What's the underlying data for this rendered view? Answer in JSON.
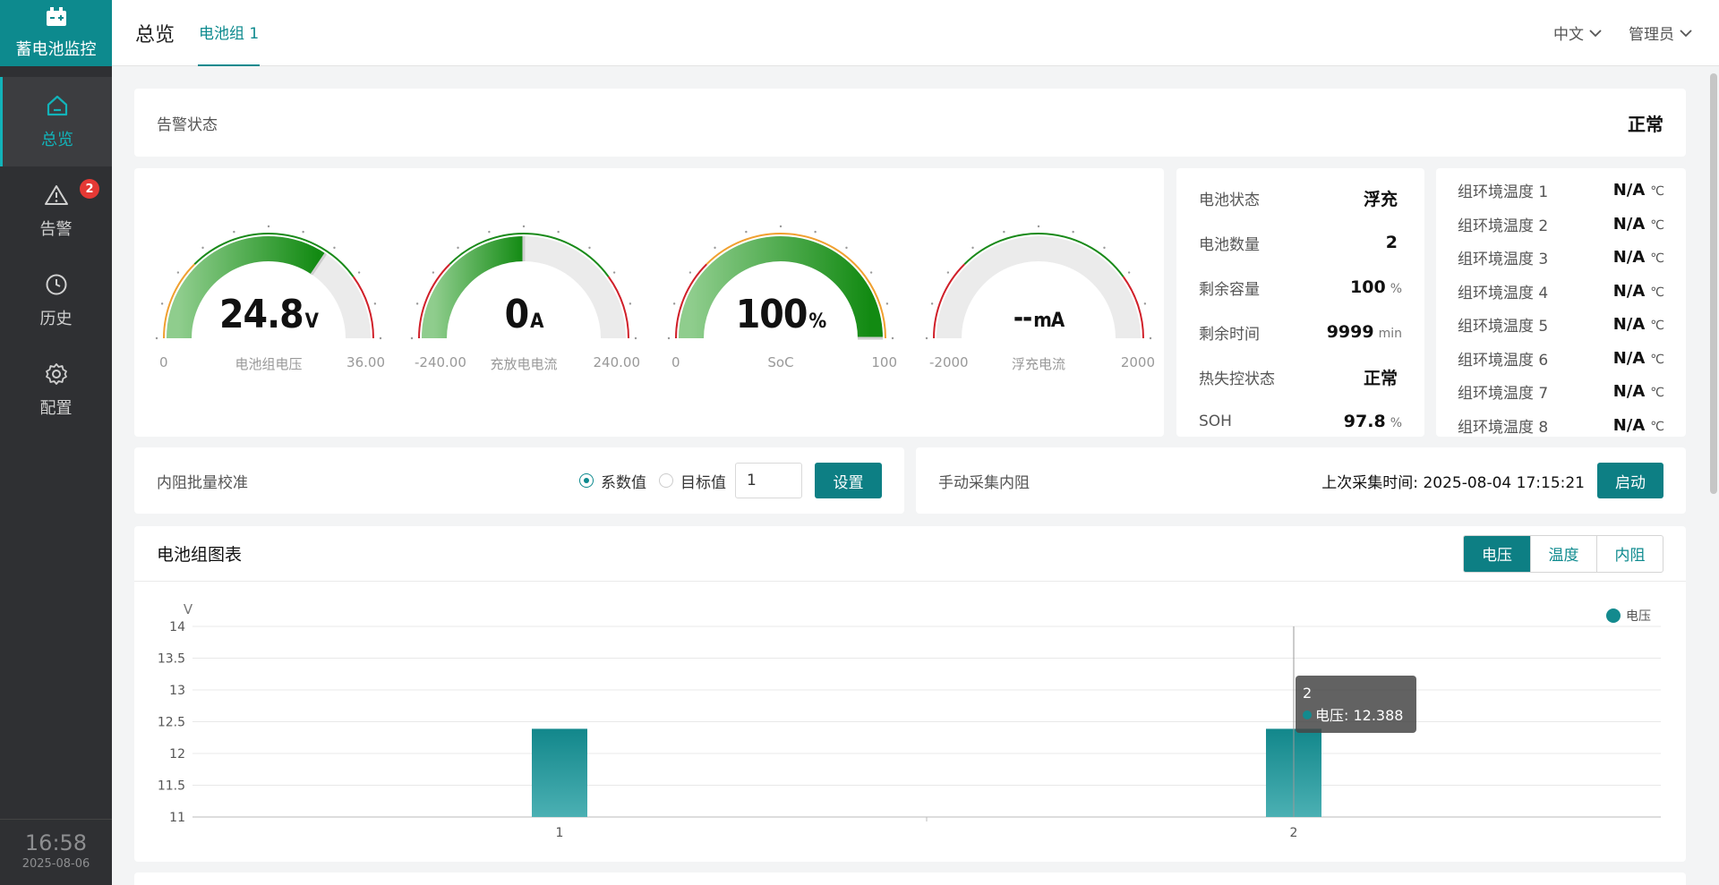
{
  "app": {
    "title": "蓄电池监控"
  },
  "nav": [
    {
      "label": "总览",
      "icon": "home-icon",
      "active": true
    },
    {
      "label": "告警",
      "icon": "warning-icon",
      "badge": "2"
    },
    {
      "label": "历史",
      "icon": "clock-icon"
    },
    {
      "label": "配置",
      "icon": "gear-icon"
    }
  ],
  "clock": {
    "time": "16:58",
    "date": "2025-08-06"
  },
  "header": {
    "title": "总览",
    "tab": "电池组 1",
    "language": "中文",
    "user": "管理员"
  },
  "alarm": {
    "label": "告警状态",
    "value": "正常"
  },
  "gauges": [
    {
      "value": "24.8",
      "unit": "V",
      "name": "电池组电压",
      "min": "0",
      "max": "36.00",
      "fill_fraction": 0.689
    },
    {
      "value": "0",
      "unit": "A",
      "name": "充放电电流",
      "min": "-240.00",
      "max": "240.00",
      "fill_fraction": 0.5
    },
    {
      "value": "100",
      "unit": "%",
      "name": "SoC",
      "min": "0",
      "max": "100",
      "fill_fraction": 1.0
    },
    {
      "value": "--",
      "unit": "mA",
      "name": "浮充电流",
      "min": "-2000",
      "max": "2000",
      "fill_fraction": 0
    }
  ],
  "status": [
    {
      "label": "电池状态",
      "value": "浮充",
      "unit": ""
    },
    {
      "label": "电池数量",
      "value": "2",
      "unit": ""
    },
    {
      "label": "剩余容量",
      "value": "100",
      "unit": "%"
    },
    {
      "label": "剩余时间",
      "value": "9999",
      "unit": "min"
    },
    {
      "label": "热失控状态",
      "value": "正常",
      "unit": ""
    },
    {
      "label": "SOH",
      "value": "97.8",
      "unit": "%"
    }
  ],
  "env": [
    {
      "label": "组环境温度 1",
      "value": "N/A",
      "unit": "℃"
    },
    {
      "label": "组环境温度 2",
      "value": "N/A",
      "unit": "℃"
    },
    {
      "label": "组环境温度 3",
      "value": "N/A",
      "unit": "℃"
    },
    {
      "label": "组环境温度 4",
      "value": "N/A",
      "unit": "℃"
    },
    {
      "label": "组环境温度 5",
      "value": "N/A",
      "unit": "℃"
    },
    {
      "label": "组环境温度 6",
      "value": "N/A",
      "unit": "℃"
    },
    {
      "label": "组环境温度 7",
      "value": "N/A",
      "unit": "℃"
    },
    {
      "label": "组环境温度 8",
      "value": "N/A",
      "unit": "℃"
    }
  ],
  "calibration": {
    "label": "内阻批量校准",
    "option_coeff": "系数值",
    "option_target": "目标值",
    "selected": "系数值",
    "input_value": "1",
    "set_button": "设置"
  },
  "manual": {
    "label": "手动采集内阻",
    "last_time_label": "上次采集时间:",
    "last_time": "2025-08-04 17:15:21",
    "start_button": "启动"
  },
  "chart_section": {
    "title": "电池组图表",
    "tabs": [
      "电压",
      "温度",
      "内阻"
    ],
    "active_tab": "电压"
  },
  "chart_data": {
    "type": "bar",
    "categories": [
      "1",
      "2"
    ],
    "series": [
      {
        "name": "电压",
        "values": [
          12.388,
          12.388
        ]
      }
    ],
    "ylabel": "V",
    "ylim": [
      11,
      14
    ],
    "yticks": [
      "14",
      "13.5",
      "13",
      "12.5",
      "12",
      "11.5",
      "11"
    ],
    "grid": true,
    "legend": "top-right",
    "tooltip": {
      "category": "2",
      "series": "电压",
      "value": "12.388"
    },
    "color": "#138a8e"
  }
}
